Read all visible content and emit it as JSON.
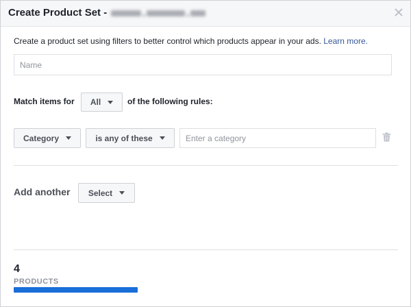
{
  "dialog": {
    "title": "Create Product Set -"
  },
  "intro": {
    "text": "Create a product set using filters to better control which products appear in your ads. ",
    "link": "Learn more."
  },
  "name_field": {
    "placeholder": "Name",
    "value": ""
  },
  "match": {
    "prefix": "Match items for",
    "selected": "All",
    "suffix": "of the following rules:"
  },
  "rules": [
    {
      "field": "Category",
      "operator": "is any of these",
      "value_placeholder": "Enter a category",
      "value": ""
    }
  ],
  "add_another": {
    "label": "Add another",
    "select_label": "Select"
  },
  "summary": {
    "count": "4",
    "unit_label": "PRODUCTS"
  },
  "icons": {
    "close": "close-icon",
    "dropdown": "caret-down-icon",
    "delete_rule": "trash-icon"
  },
  "colors": {
    "header_bg": "#f6f7f9",
    "link": "#365899",
    "text": "#1d2129",
    "muted": "#90949c",
    "progress_bar": "#1a6ed8"
  }
}
